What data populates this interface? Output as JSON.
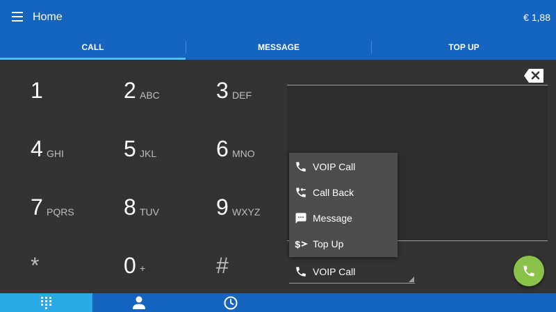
{
  "header": {
    "title": "Home",
    "balance": "€ 1,88",
    "menu_icon": "menu-icon"
  },
  "tabs": [
    {
      "label": "CALL",
      "active": true
    },
    {
      "label": "MESSAGE",
      "active": false
    },
    {
      "label": "TOP UP",
      "active": false
    }
  ],
  "dialpad": [
    {
      "digit": "1",
      "letters": ""
    },
    {
      "digit": "2",
      "letters": "ABC"
    },
    {
      "digit": "3",
      "letters": "DEF"
    },
    {
      "digit": "4",
      "letters": "GHI"
    },
    {
      "digit": "5",
      "letters": "JKL"
    },
    {
      "digit": "6",
      "letters": "MNO"
    },
    {
      "digit": "7",
      "letters": "PQRS"
    },
    {
      "digit": "8",
      "letters": "TUV"
    },
    {
      "digit": "9",
      "letters": "WXYZ"
    },
    {
      "digit": "*",
      "letters": ""
    },
    {
      "digit": "0",
      "letters": "+"
    },
    {
      "digit": "#",
      "letters": ""
    }
  ],
  "call_type_menu": {
    "items": [
      {
        "label": "VOIP Call",
        "icon": "phone-icon"
      },
      {
        "label": "Call Back",
        "icon": "call-back-icon"
      },
      {
        "label": "Message",
        "icon": "message-icon"
      },
      {
        "label": "Top Up",
        "icon": "top-up-icon"
      }
    ],
    "selected": "VOIP Call"
  },
  "bottom_nav": [
    {
      "name": "dialpad",
      "icon": "dialpad-icon",
      "active": true
    },
    {
      "name": "contacts",
      "icon": "person-icon",
      "active": false
    },
    {
      "name": "history",
      "icon": "clock-icon",
      "active": false
    }
  ],
  "colors": {
    "primary": "#1565c0",
    "tab_indicator": "#4fc3f7",
    "call_button": "#8bc34a",
    "background": "#333333",
    "active_nav": "#29a9e6"
  }
}
